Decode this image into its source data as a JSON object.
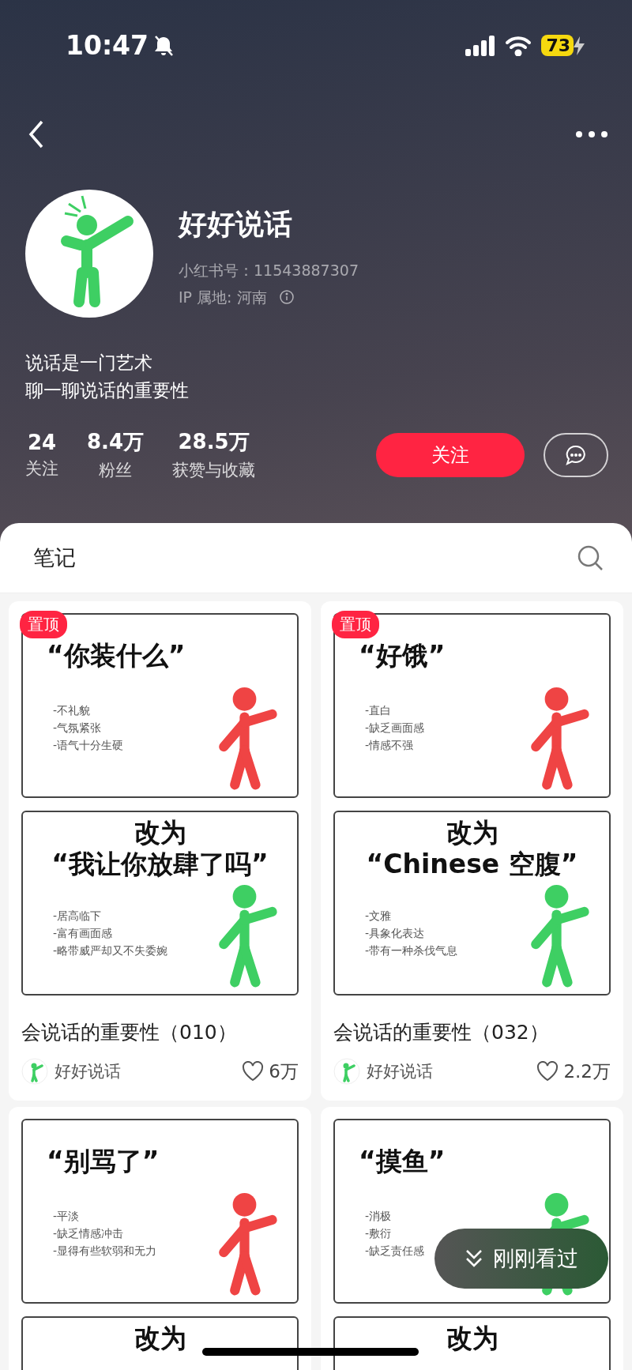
{
  "status_bar": {
    "time": "10:47",
    "battery": "73"
  },
  "profile": {
    "name": "好好说话",
    "account_id": "小红书号：11543887307",
    "ip_location": "IP 属地: 河南",
    "bio": [
      "说话是一门艺术",
      "聊一聊说话的重要性"
    ],
    "stats": [
      {
        "value": "24",
        "label": "关注"
      },
      {
        "value": "8.4万",
        "label": "粉丝"
      },
      {
        "value": "28.5万",
        "label": "获赞与收藏"
      }
    ],
    "follow_button": "关注"
  },
  "tabs": [
    {
      "label": "笔记",
      "selected": true
    }
  ],
  "notes": [
    {
      "badge": "置顶",
      "panels": [
        {
          "kind": "before",
          "heading": [
            "“你装什么”"
          ],
          "bullets": [
            "-不礼貌",
            "-气氛紧张",
            "-语气十分生硬"
          ],
          "color": "#ef4444"
        },
        {
          "kind": "after",
          "heading": [
            "改为",
            "“我让你放肆了吗”"
          ],
          "bullets": [
            "-居高临下",
            "-富有画面感",
            "-略带威严却又不失委婉"
          ],
          "color": "#3ecf63"
        }
      ],
      "title": "会说话的重要性（010）",
      "author": "好好说话",
      "likes": "6万"
    },
    {
      "badge": "置顶",
      "panels": [
        {
          "kind": "before",
          "heading": [
            "“好饿”"
          ],
          "bullets": [
            "-直白",
            "-缺乏画面感",
            "-情感不强"
          ],
          "color": "#ef4444"
        },
        {
          "kind": "after",
          "heading": [
            "改为",
            "“Chinese 空腹”"
          ],
          "bullets": [
            "-文雅",
            "-具象化表达",
            "-带有一种杀伐气息"
          ],
          "color": "#3ecf63"
        }
      ],
      "title": "会说话的重要性（032）",
      "author": "好好说话",
      "likes": "2.2万"
    },
    {
      "panels": [
        {
          "kind": "before",
          "heading": [
            "“别骂了”"
          ],
          "bullets": [
            "-平淡",
            "-缺乏情感冲击",
            "-显得有些软弱和无力"
          ],
          "color": "#ef4444"
        },
        {
          "kind": "after",
          "heading": [
            "改为"
          ]
        }
      ]
    },
    {
      "panels": [
        {
          "kind": "before",
          "heading": [
            "“摸鱼”"
          ],
          "bullets": [
            "-消极",
            "-敷衍",
            "-缺乏责任感"
          ],
          "color": "#3ecf63"
        },
        {
          "kind": "after",
          "heading": [
            "改为"
          ]
        }
      ]
    }
  ],
  "recently_viewed_button": "刚刚看过"
}
